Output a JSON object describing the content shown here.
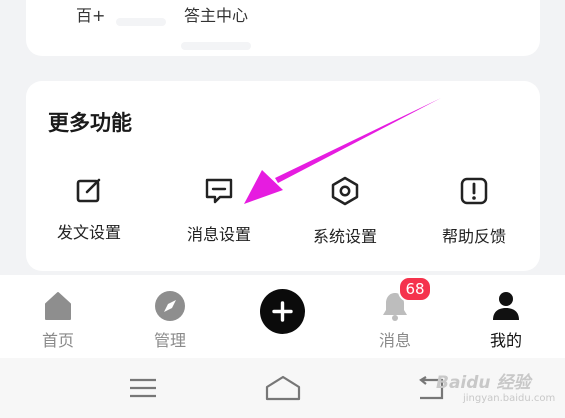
{
  "top_card": {
    "left_text": "百+",
    "right_text": "答主中心"
  },
  "more_functions": {
    "title": "更多功能",
    "items": [
      {
        "label": "发文设置",
        "icon": "edit-icon"
      },
      {
        "label": "消息设置",
        "icon": "message-icon"
      },
      {
        "label": "系统设置",
        "icon": "settings-hexagon-icon"
      },
      {
        "label": "帮助反馈",
        "icon": "help-alert-icon"
      }
    ]
  },
  "tabbar": {
    "tabs": [
      {
        "label": "首页",
        "icon": "home-icon",
        "active": false
      },
      {
        "label": "管理",
        "icon": "compass-icon",
        "active": false
      },
      {
        "label": "消息",
        "icon": "bell-icon",
        "active": false,
        "badge": "68"
      },
      {
        "label": "我的",
        "icon": "user-icon",
        "active": true
      }
    ],
    "post_icon": "plus-icon"
  },
  "system_nav": [
    "menu-icon",
    "home-outline-icon",
    "back-icon"
  ],
  "watermark": {
    "logo": "Baidu 经验",
    "url": "jingyan.baidu.com"
  },
  "colors": {
    "accent_arrow": "#e61ce0",
    "badge": "#f5334d",
    "active_text": "#111111",
    "inactive_text": "#8a8a8a"
  }
}
